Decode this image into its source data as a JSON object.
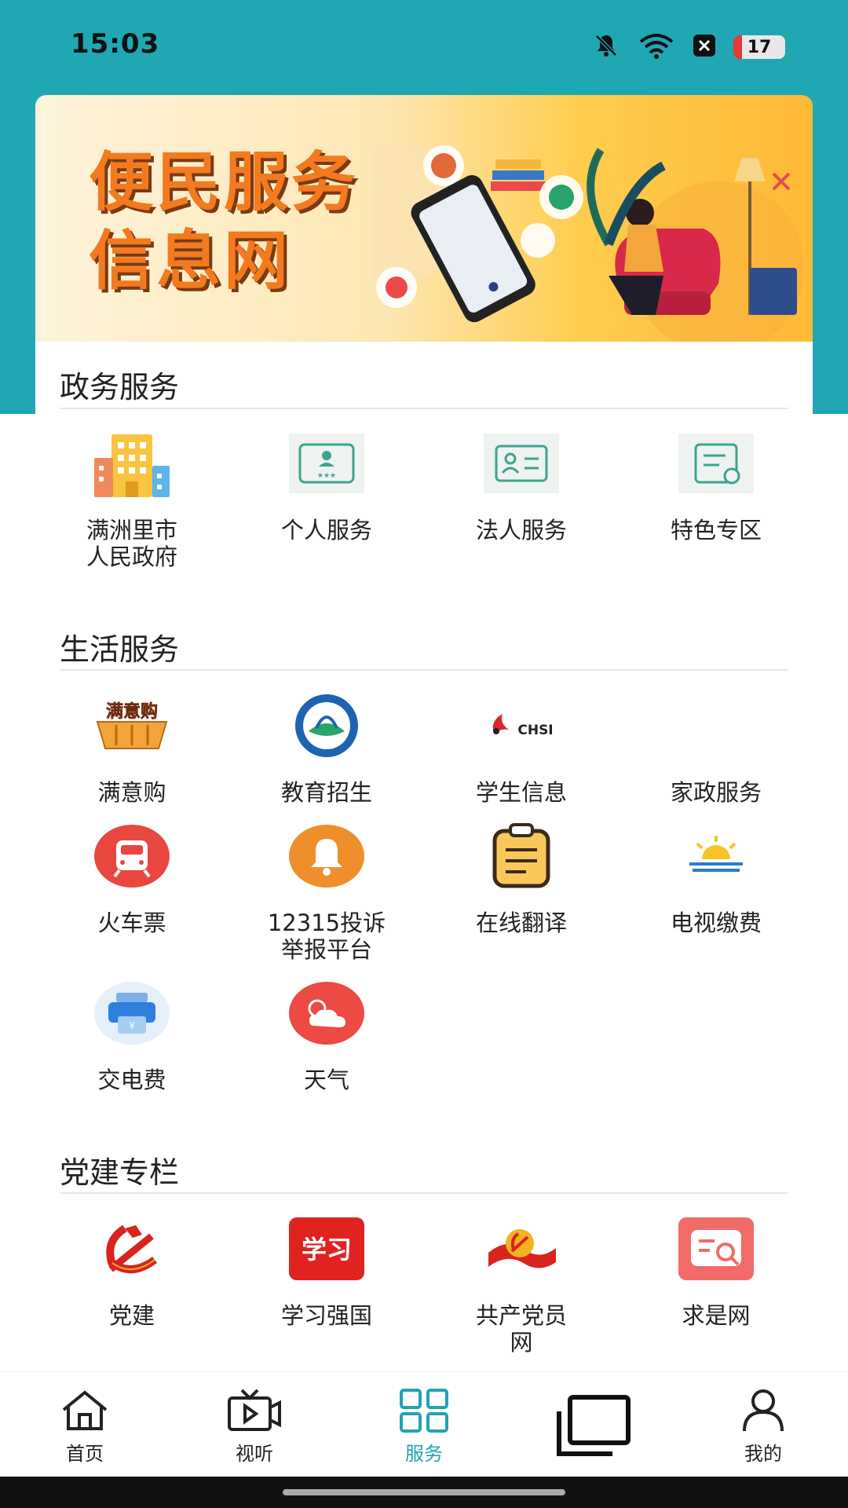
{
  "status_bar": {
    "time": "15:03",
    "battery": "17",
    "icons": [
      "bell-off-icon",
      "wifi-icon",
      "close-box-icon",
      "battery-icon"
    ]
  },
  "banner": {
    "title_line1": "便民服务",
    "title_line2": "信息网"
  },
  "sections": [
    {
      "title": "政务服务",
      "items": [
        {
          "label": "满洲里市\n人民政府",
          "icon": "government-building-icon"
        },
        {
          "label": "个人服务",
          "icon": "id-card-icon"
        },
        {
          "label": "法人服务",
          "icon": "contact-card-icon"
        },
        {
          "label": "特色专区",
          "icon": "document-refresh-icon"
        }
      ]
    },
    {
      "title": "生活服务",
      "items": [
        {
          "label": "满意购",
          "icon": "shopping-basket-icon"
        },
        {
          "label": "教育招生",
          "icon": "education-logo-icon"
        },
        {
          "label": "学生信息",
          "icon": "chsi-logo-icon"
        },
        {
          "label": "家政服务",
          "icon": "housekeeping-icon"
        },
        {
          "label": "火车票",
          "icon": "train-icon"
        },
        {
          "label": "12315投诉\n举报平台",
          "icon": "bell-icon"
        },
        {
          "label": "在线翻译",
          "icon": "clipboard-icon"
        },
        {
          "label": "电视缴费",
          "icon": "sunrise-icon"
        },
        {
          "label": "交电费",
          "icon": "printer-icon"
        },
        {
          "label": "天气",
          "icon": "weather-icon"
        }
      ]
    },
    {
      "title": "党建专栏",
      "items": [
        {
          "label": "党建",
          "icon": "party-emblem-icon"
        },
        {
          "label": "学习强国",
          "icon": "xuexi-logo-icon"
        },
        {
          "label": "共产党员\n网",
          "icon": "party-flag-icon"
        },
        {
          "label": "求是网",
          "icon": "qiushi-logo-icon"
        }
      ]
    }
  ],
  "chsi_text": "CHSI",
  "manyi_text": "满意购",
  "xuexi_text": "学习",
  "nav": {
    "items": [
      {
        "label": "首页",
        "icon": "home-icon"
      },
      {
        "label": "视听",
        "icon": "tv-play-icon"
      },
      {
        "label": "服务",
        "icon": "grid-icon"
      },
      {
        "label": "",
        "icon": "windows-icon"
      },
      {
        "label": "我的",
        "icon": "user-icon"
      }
    ],
    "active": "服务",
    "active_color": "#22a4b0"
  },
  "colors": {
    "header_teal": "#1fa7b3",
    "banner_orange": "#f47a1f"
  }
}
